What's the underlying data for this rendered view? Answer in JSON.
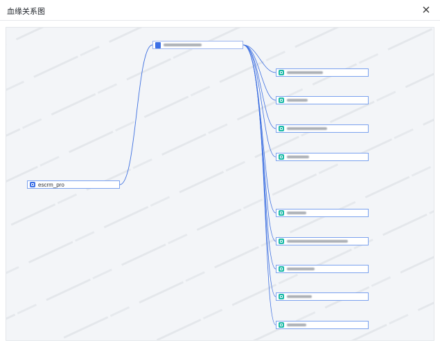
{
  "dialog": {
    "title": "血缘关系图",
    "close_icon": "close-icon"
  },
  "graph": {
    "source_node": {
      "label": "escrm_pro",
      "icon": "database-icon"
    },
    "center_node": {
      "label": "",
      "icon": "table-icon"
    },
    "target_nodes": [
      {
        "label": "",
        "icon": "field-icon"
      },
      {
        "label": "",
        "icon": "field-icon"
      },
      {
        "label": "",
        "icon": "field-icon"
      },
      {
        "label": "",
        "icon": "field-icon"
      },
      {
        "label": "",
        "icon": "field-icon"
      },
      {
        "label": "",
        "icon": "field-icon"
      },
      {
        "label": "",
        "icon": "field-icon"
      },
      {
        "label": "",
        "icon": "field-icon"
      },
      {
        "label": "",
        "icon": "field-icon"
      }
    ],
    "edge_color": "#3d6fe0",
    "node_border_color": "#7aa1ee"
  }
}
